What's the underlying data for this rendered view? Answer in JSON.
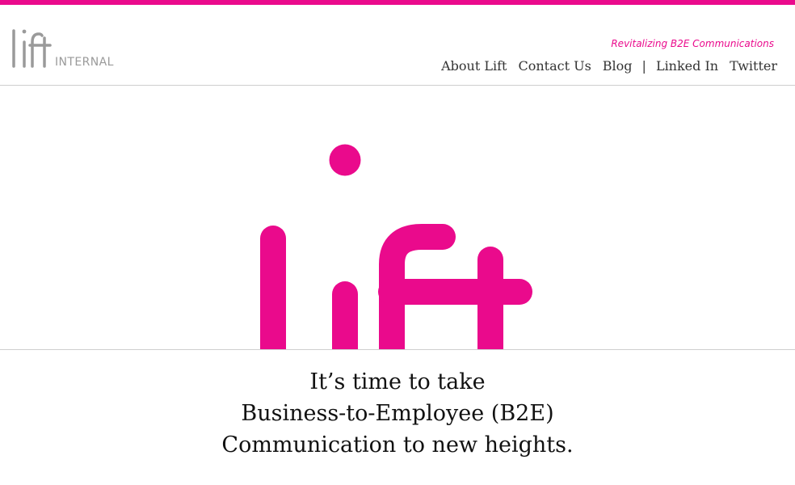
{
  "brand": {
    "logo_word": "lift",
    "logo_suffix": "INTERNAL",
    "tagline": "Revitalizing B2E Communications"
  },
  "nav": {
    "items": [
      {
        "label": "About Lift"
      },
      {
        "label": "Contact Us"
      },
      {
        "label": "Blog"
      },
      {
        "label": "Linked In"
      },
      {
        "label": "Twitter"
      }
    ],
    "separator": "|"
  },
  "hero": {
    "logo_word": "lift"
  },
  "headline": {
    "lines": [
      "It’s time to take",
      "Business-to-Employee (B2E)",
      "Communication to new heights."
    ]
  },
  "colors": {
    "brand_pink": "#ea0a8c",
    "logo_gray": "#9a9a9a",
    "divider": "#cfcfcf"
  }
}
